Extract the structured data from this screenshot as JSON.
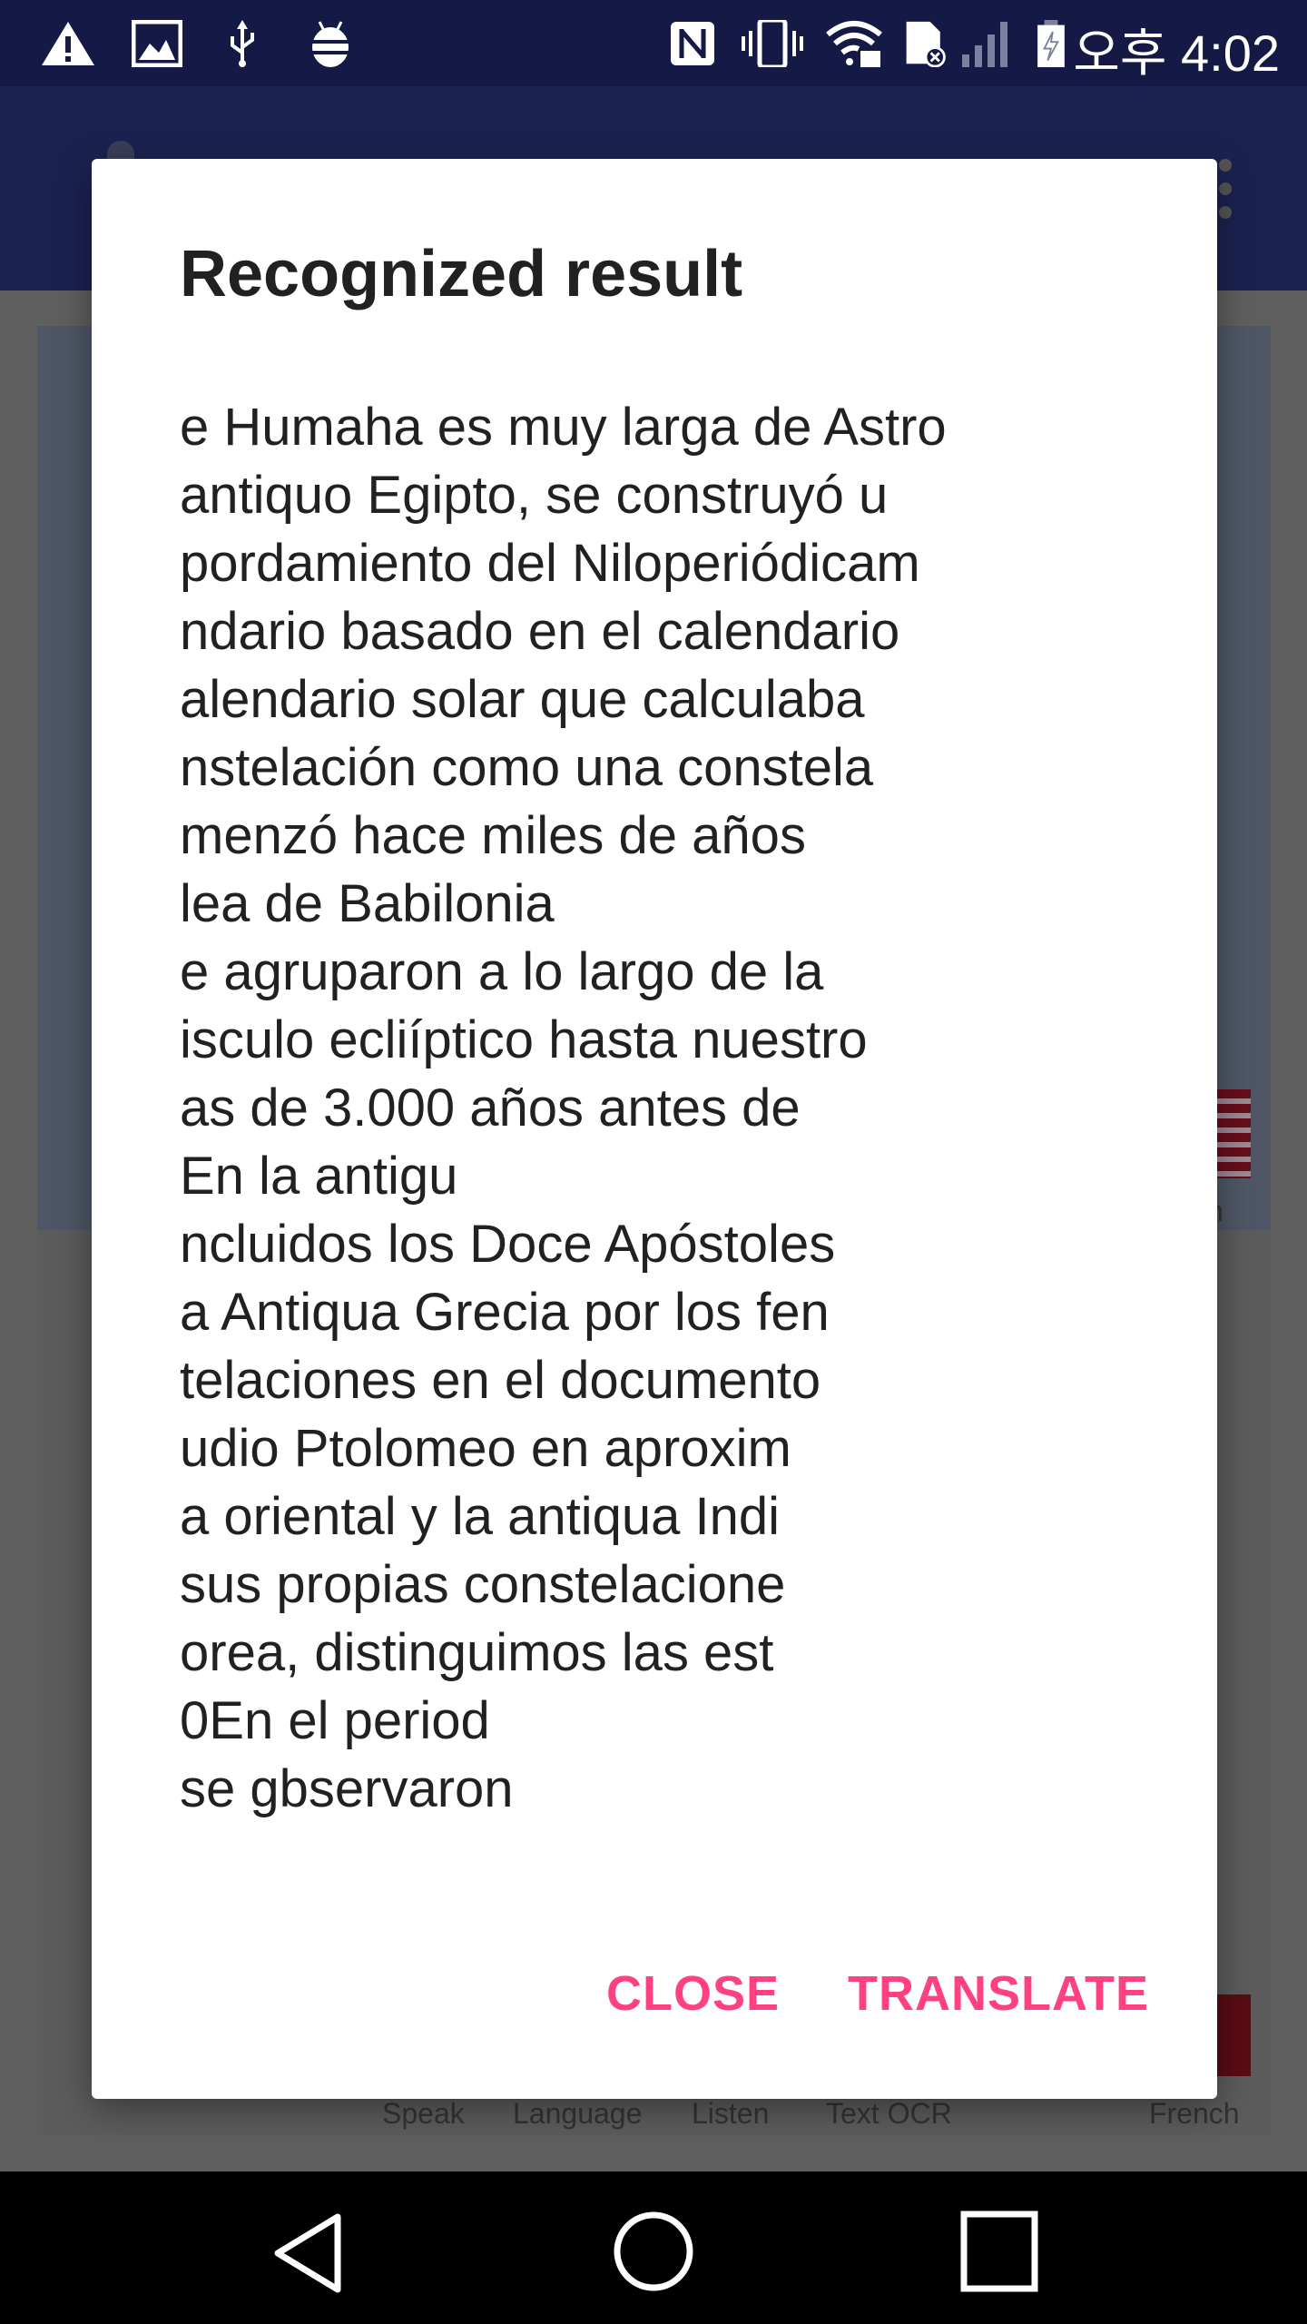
{
  "status_bar": {
    "left_icons": [
      "warning-icon",
      "image-icon",
      "usb-icon",
      "android-debug-icon"
    ],
    "right_icons": [
      "nfc-icon",
      "vibrate-icon",
      "wifi-lock-icon",
      "sd-card-error-icon",
      "signal-icon",
      "battery-charging-icon"
    ],
    "time": "오후 4:02"
  },
  "background": {
    "partial_label": "sh",
    "bottom_labels": [
      "Speak",
      "Language",
      "Listen",
      "Text OCR",
      "French"
    ]
  },
  "dialog": {
    "title": "Recognized result",
    "lines": [
      "e Humaha es muy larga de Astro",
      "antiquo Egipto, se construyó u",
      "pordamiento del Niloperiódicam",
      "ndario basado en el calendario",
      "alendario solar que calculaba",
      "nstelación como una constela",
      "menzó hace miles de años",
      "lea de Babilonia",
      "e agruparon a lo largo de la",
      "isculo ecliíptico hasta nuestro",
      "as de 3.000 años antes de",
      "En la antigu",
      "ncluidos los Doce Apóstoles",
      "a Antiqua Grecia por los fen",
      "telaciones en el documento",
      "udio Ptolomeo en aproxim",
      "a oriental y la antiqua Indi",
      "sus propias constelacione",
      "orea, distinguimos las est",
      "0En el period",
      "se gbservaron"
    ],
    "close_label": "CLOSE",
    "translate_label": "TRANSLATE",
    "accent_color": "#ff4081"
  },
  "nav_bar": {
    "icons": [
      "back-icon",
      "home-icon",
      "recents-icon"
    ]
  }
}
